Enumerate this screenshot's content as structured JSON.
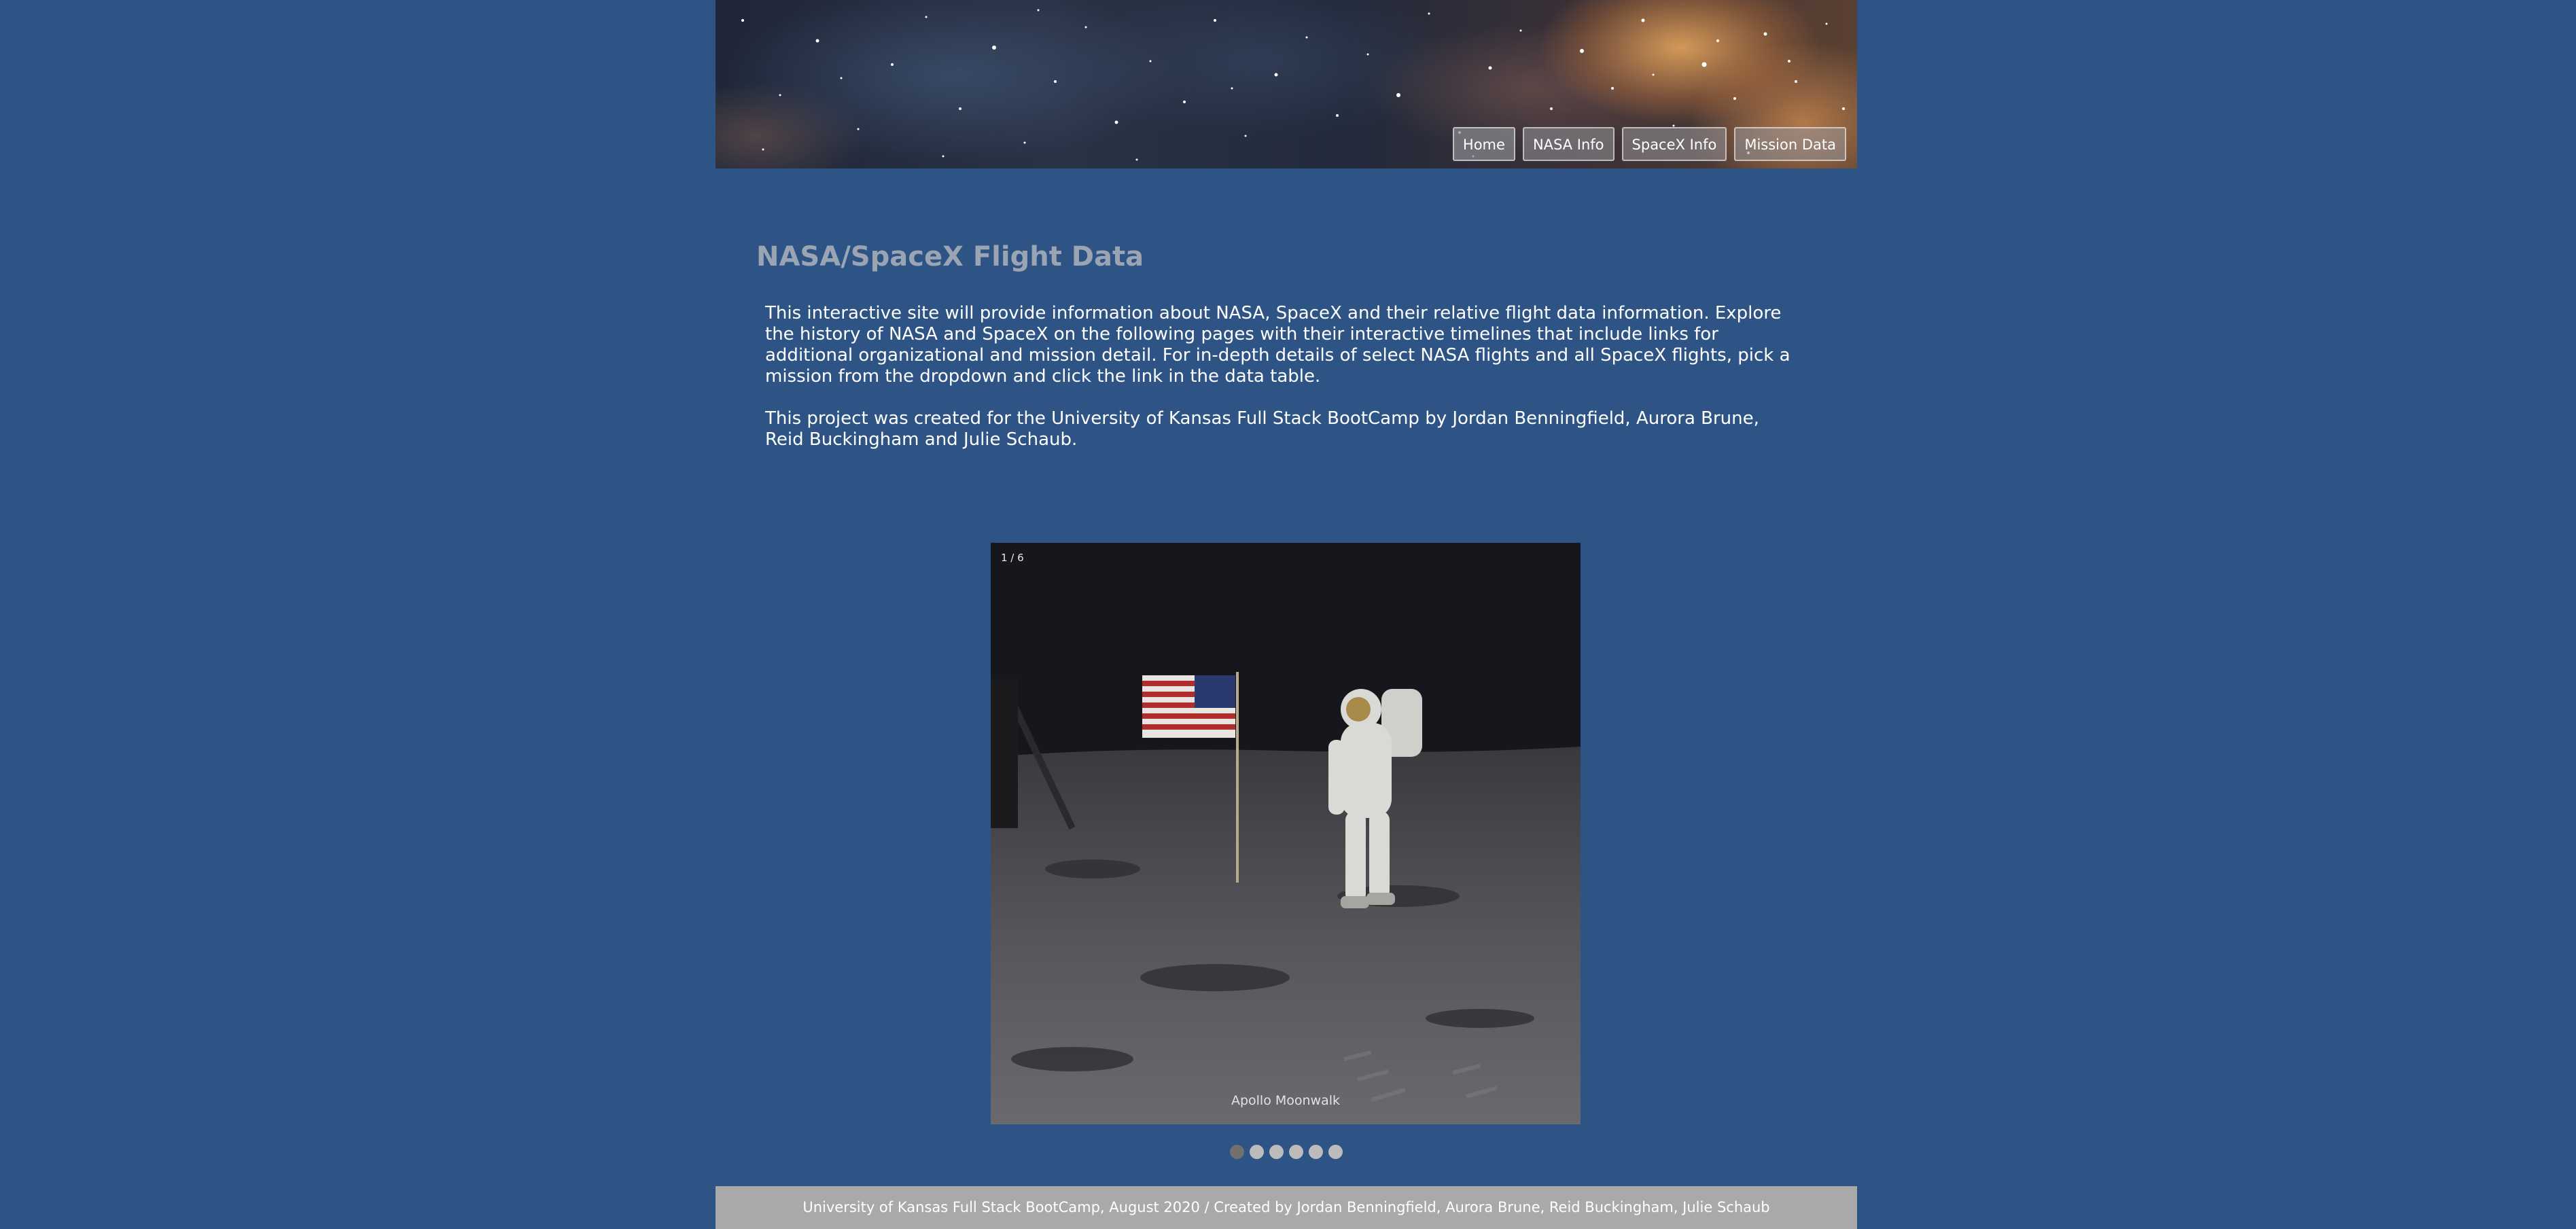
{
  "nav": {
    "items": [
      {
        "label": "Home",
        "active": true
      },
      {
        "label": "NASA Info",
        "active": false
      },
      {
        "label": "SpaceX Info",
        "active": false
      },
      {
        "label": "Mission Data",
        "active": false
      }
    ]
  },
  "main": {
    "title": "NASA/SpaceX Flight Data",
    "paragraphs": [
      "This interactive site will provide information about NASA, SpaceX and their relative flight data information. Explore the history of NASA and SpaceX on the following pages with their interactive timelines that include links for additional organizational and mission detail. For in-depth details of select NASA flights and all SpaceX flights, pick a mission from the dropdown and click the link in the data table.",
      "This project was created for the University of Kansas Full Stack BootCamp by Jordan Benningfield, Aurora Brune, Reid Buckingham and Julie Schaub."
    ]
  },
  "slideshow": {
    "counter": "1 / 6",
    "caption": "Apollo Moonwalk",
    "current_slide": 1,
    "total_slides": 6
  },
  "footer": {
    "text": "University of Kansas Full Stack BootCamp, August 2020 / Created by Jordan Benningfield, Aurora Brune, Reid Buckingham, Julie Schaub"
  },
  "colors": {
    "page_background": "#2e5486",
    "footer_background": "#a9a9a9",
    "title_color": "#9aa4b3"
  }
}
